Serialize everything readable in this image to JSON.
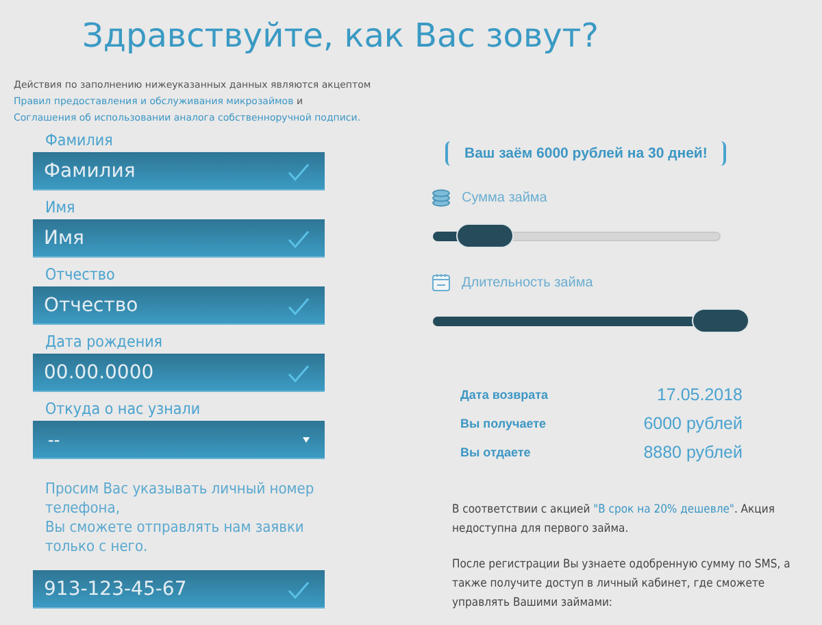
{
  "title": "Здравствуйте, как Вас зовут?",
  "intro": {
    "text": "Действия по заполнению нижеуказанных данных являются акцептом",
    "link_1": "Правил предоставления и обслуживания микрозаймов",
    "joiner": "и",
    "link_2": "Соглашения об использовании аналога собственноручной подписи."
  },
  "fields": [
    {
      "kind": "text",
      "label": "Фамилия",
      "placeholder": "Фамилия",
      "valid": true
    },
    {
      "kind": "text",
      "label": "Имя",
      "placeholder": "Имя",
      "valid": true
    },
    {
      "kind": "text",
      "label": "Отчество",
      "placeholder": "Отчество",
      "valid": true
    },
    {
      "kind": "text",
      "label": "Дата рождения",
      "placeholder": "00.00.0000",
      "valid": true
    },
    {
      "kind": "select",
      "label": "Откуда о нас узнали",
      "value": "--"
    }
  ],
  "phone_note": [
    "Просим Вас указывать личный номер телефона,",
    "Вы сможете отправлять нам заявки только с него."
  ],
  "phone": {
    "value": "913-123-45-67",
    "valid": true
  },
  "promo": "Ваш заём 6000 рублей на 30 дней!",
  "sliders": [
    {
      "kind": "coins",
      "label": "Сумма займа",
      "level": 0.18
    },
    {
      "kind": "calendar",
      "label": "Длительность займа",
      "level": 1
    }
  ],
  "summary": [
    {
      "label": "Дата возврата",
      "value": "17.05.2018"
    },
    {
      "label": "Вы получаете",
      "value": "6000 рублей"
    },
    {
      "label": "Вы отдаете",
      "value": "8880 рублей"
    }
  ],
  "offer": {
    "before": "В соответствии с акцией",
    "link": "\"В срок на 20% дешевле\"",
    "after": ". Акция недоступна для первого займа."
  },
  "after_registration": "После регистрации Вы узнаете одобренную сумму по SMS, а также получите доступ в личный кабинет, где сможете управлять Вашими займами:"
}
